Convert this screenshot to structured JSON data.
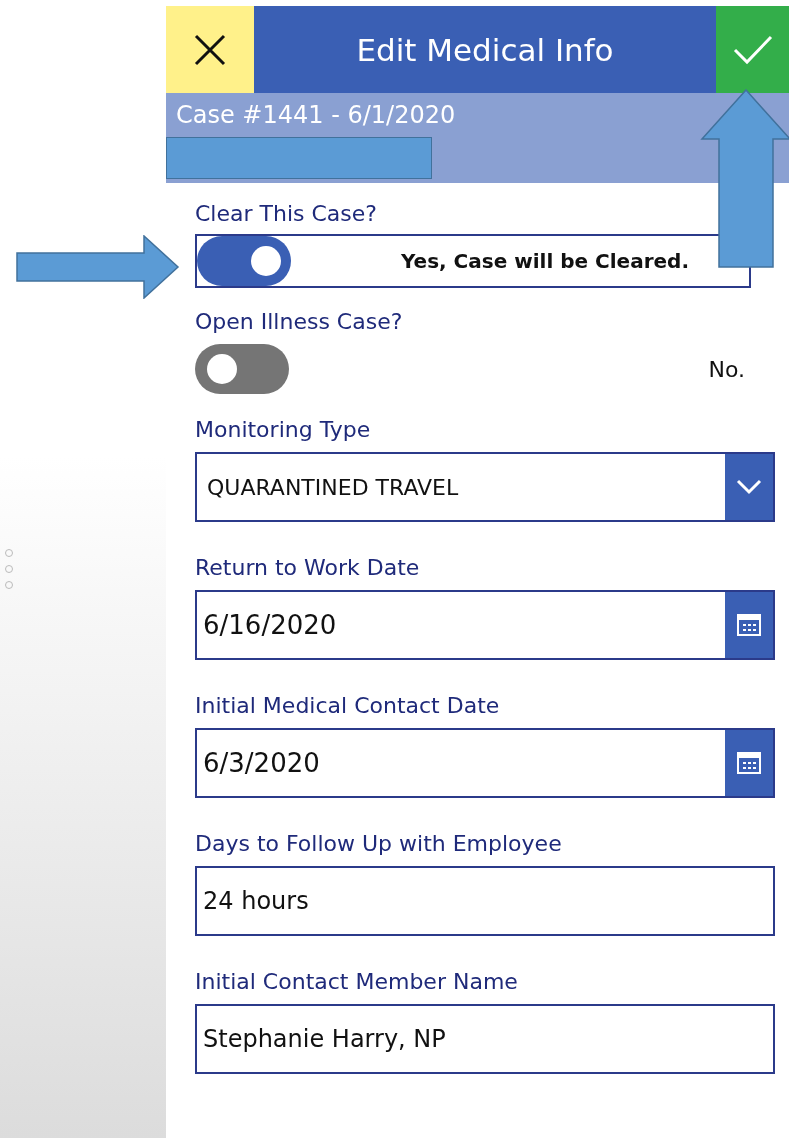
{
  "header": {
    "title": "Edit Medical Info"
  },
  "subheader": {
    "case": "Case #1441 - 6/1/2020"
  },
  "fields": [
    {
      "kind": "toggle",
      "label": "Clear This Case?",
      "on": true,
      "outlined": true,
      "status": "Yes, Case will be Cleared."
    },
    {
      "kind": "toggle",
      "label": "Open Illness Case?",
      "on": false,
      "outlined": false,
      "status": "No."
    },
    {
      "kind": "dropdown",
      "label": "Monitoring Type",
      "value": "QUARANTINED TRAVEL"
    },
    {
      "kind": "date",
      "label": "Return to Work Date",
      "value": "6/16/2020"
    },
    {
      "kind": "date",
      "label": "Initial Medical Contact Date",
      "value": "6/3/2020"
    },
    {
      "kind": "text",
      "label": "Days to Follow Up with Employee",
      "value": "24 hours"
    },
    {
      "kind": "text",
      "label": "Initial Contact Member Name",
      "value": "Stephanie Harry, NP"
    }
  ]
}
